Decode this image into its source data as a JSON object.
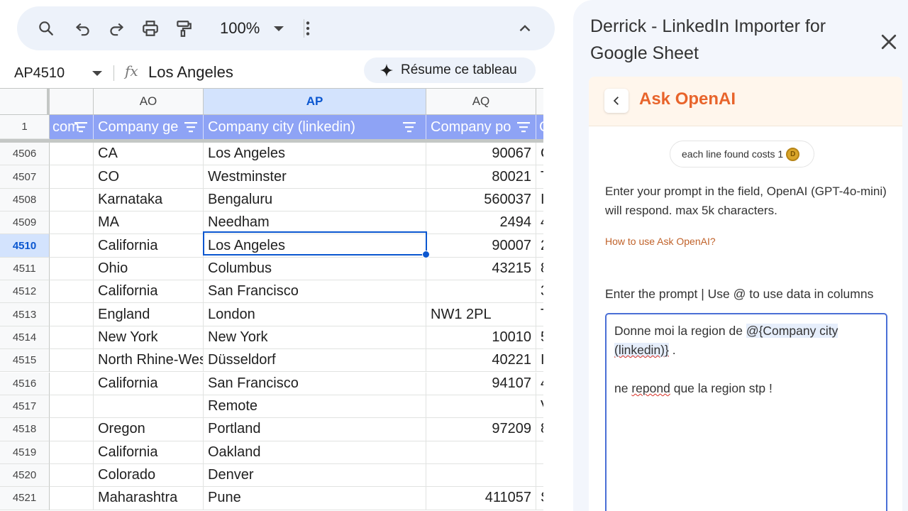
{
  "toolbar": {
    "zoom": "100%",
    "icons": [
      "search-icon",
      "undo-icon",
      "redo-icon",
      "print-icon",
      "paint-format-icon",
      "more-vert-icon",
      "chevron-up-icon"
    ]
  },
  "formula_bar": {
    "name_box": "AP4510",
    "fx": "fx",
    "value": "Los Angeles",
    "summarize_label": "Résume ce tableau"
  },
  "grid": {
    "columns": [
      "AO",
      "AP",
      "AQ"
    ],
    "selected_column": "AP",
    "header_row_number": "1",
    "header_cells": [
      "com",
      "Company ge",
      "Company city (linkedin)",
      "Company po",
      "C"
    ],
    "rows": [
      {
        "n": "4506",
        "state": "CA",
        "city": "Los Angeles",
        "postal": "90067",
        "next": "C"
      },
      {
        "n": "4507",
        "state": "CO",
        "city": "Westminster",
        "postal": "80021",
        "next": "T"
      },
      {
        "n": "4508",
        "state": "Karnataka",
        "city": "Bengaluru",
        "postal": "560037",
        "next": "I"
      },
      {
        "n": "4509",
        "state": "MA",
        "city": "Needham",
        "postal": "2494",
        "next": "4"
      },
      {
        "n": "4510",
        "state": "California",
        "city": "Los Angeles",
        "postal": "90007",
        "next": "2"
      },
      {
        "n": "4511",
        "state": "Ohio",
        "city": "Columbus",
        "postal": "43215",
        "next": "8"
      },
      {
        "n": "4512",
        "state": "California",
        "city": "San Francisco",
        "postal": "",
        "next": "3"
      },
      {
        "n": "4513",
        "state": "England",
        "city": "London",
        "postal": "NW1 2PL",
        "next": "T"
      },
      {
        "n": "4514",
        "state": "New York",
        "city": "New York",
        "postal": "10010",
        "next": "5"
      },
      {
        "n": "4515",
        "state": "North Rhine-Westphalia",
        "city": "Düsseldorf",
        "postal": "40221",
        "next": "I"
      },
      {
        "n": "4516",
        "state": "California",
        "city": "San Francisco",
        "postal": "94107",
        "next": "4"
      },
      {
        "n": "4517",
        "state": "",
        "city": "Remote",
        "postal": "",
        "next": "V"
      },
      {
        "n": "4518",
        "state": "Oregon",
        "city": "Portland",
        "postal": "97209",
        "next": "8"
      },
      {
        "n": "4519",
        "state": "California",
        "city": "Oakland",
        "postal": "",
        "next": ""
      },
      {
        "n": "4520",
        "state": "Colorado",
        "city": "Denver",
        "postal": "",
        "next": ""
      },
      {
        "n": "4521",
        "state": "Maharashtra",
        "city": "Pune",
        "postal": "411057",
        "next": "S"
      }
    ],
    "selected_row": "4510"
  },
  "panel": {
    "title": "Derrick - LinkedIn Importer for Google Sheet",
    "card_title": "Ask OpenAI",
    "cost_text": "each line found costs 1",
    "description": "Enter your prompt in the field, OpenAI (GPT-4o-mini) will respond. max 5k characters.",
    "howto_link": "How to use Ask OpenAI?",
    "prompt_label": "Enter the prompt | Use @ to use data in columns",
    "prompt": {
      "line1_prefix": "Donne moi la region de ",
      "mention_part1": "@{Company city",
      "mention_part2": "(linkedin)}",
      "line1_suffix": " .",
      "line3_word1": "ne",
      "line3_word2": "repond",
      "line3_rest": " que la region stp !"
    },
    "colors": {
      "accent": "#e8642b",
      "header_band": "#8ea3f5",
      "selection": "#0b57d0"
    }
  }
}
